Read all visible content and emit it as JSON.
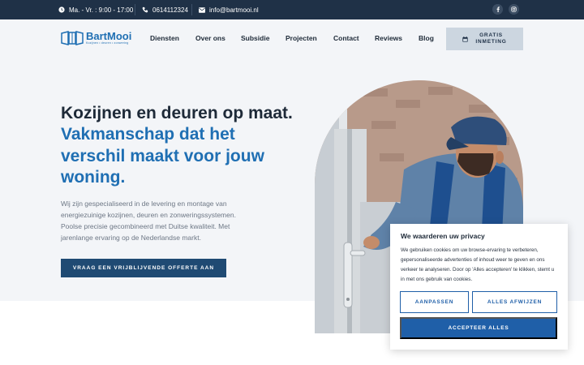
{
  "topbar": {
    "hours": "Ma. - Vr. : 9:00 - 17:00",
    "phone": "0614112324",
    "email": "info@bartmooi.nl",
    "socials": [
      "facebook-icon",
      "instagram-icon"
    ]
  },
  "header": {
    "logo_text": "BartMooi",
    "logo_tagline": "Kozijnen • deuren • zonwering",
    "nav": [
      "Diensten",
      "Over ons",
      "Subsidie",
      "Projecten",
      "Contact",
      "Reviews",
      "Blog"
    ],
    "cta_line1": "GRATIS",
    "cta_line2": "INMETING"
  },
  "hero": {
    "heading_line1": "Kozijnen en deuren op maat.",
    "heading_line2": "Vakmanschap dat het",
    "heading_line3": "verschil maakt voor jouw",
    "heading_line4": "woning.",
    "description": "Wij zijn gespecialiseerd in de levering en montage van energiezuinige kozijnen, deuren en zonweringssystemen. Poolse precisie gecombineerd met Duitse kwaliteit. Met jarenlange ervaring op de Nederlandse markt.",
    "cta": "VRAAG EEN VRIJBLIJVENDE OFFERTE AAN"
  },
  "cookie": {
    "title": "We waarderen uw privacy",
    "text": "We gebruiken cookies om uw browse-ervaring te verbeteren, gepersonaliseerde advertenties of inhoud weer te geven en ons verkeer te analyseren. Door op 'Alles accepteren' te klikken, stemt u in met ons gebruik van cookies.",
    "customize": "AANPASSEN",
    "reject": "ALLES AFWIJZEN",
    "accept": "ACCEPTEER ALLES"
  },
  "colors": {
    "topbar_bg": "#1f3147",
    "brand_blue": "#1f6fb3",
    "button_dark": "#1f4a73",
    "cookie_blue": "#1f5fa8"
  }
}
